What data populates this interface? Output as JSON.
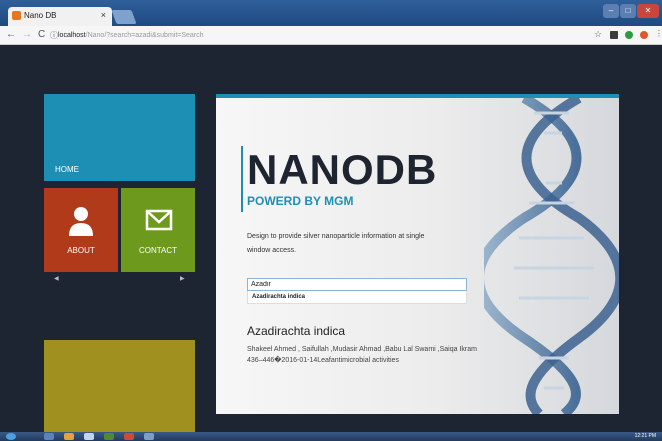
{
  "browser": {
    "tab_title": "Nano DB",
    "tab_close": "×",
    "url_host": "localhost",
    "url_rest": "/Nano/?search=azadi&submit=Search",
    "back": "←",
    "forward": "→",
    "reload": "C",
    "info": "ⓘ",
    "star": "☆"
  },
  "sidebar": {
    "home_label": "HOME",
    "about_label": "ABOUT",
    "contact_label": "CONTACT",
    "prev_arrow": "◀",
    "next_arrow": "▶"
  },
  "main": {
    "title": "NANODB",
    "subtitle": "POWERD BY MGM",
    "description": "Design to provide silver nanoparticle information at single window access.",
    "search_value": "Azadir",
    "suggestion": "Azadirachta indica",
    "result_title": "Azadirachta indica",
    "result_meta": "Shakeel Ahmed , Saifullah ,Mudasir Ahmad ,Babu Lal Swami ,Saiqa Ikram 436–446�2016-01-14Leafantimicrobial activities"
  },
  "taskbar": {
    "clock": "12:21 PM"
  },
  "colors": {
    "accent": "#1e8fb4",
    "about": "#b03a1a",
    "contact": "#6d9a1d",
    "olive": "#a09020",
    "page_bg": "#1d2533"
  }
}
